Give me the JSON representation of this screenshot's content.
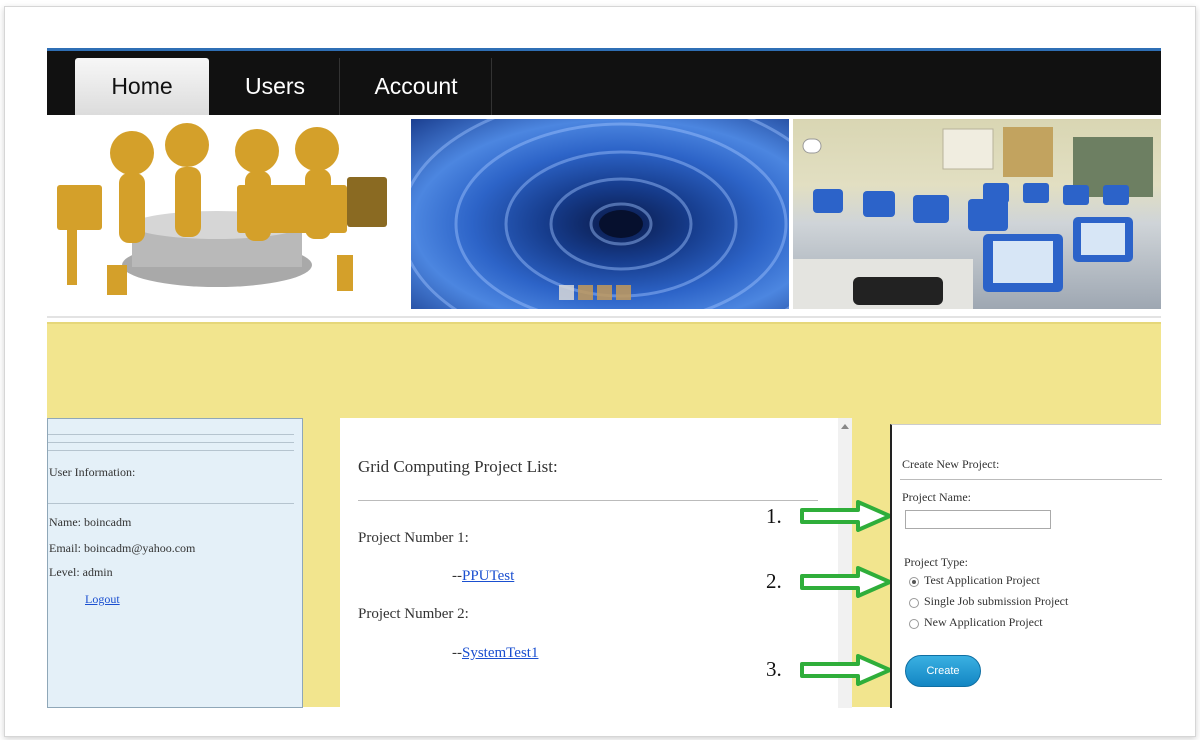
{
  "nav": {
    "tabs": [
      {
        "label": "Home",
        "active": true
      },
      {
        "label": "Users",
        "active": false
      },
      {
        "label": "Account",
        "active": false
      }
    ]
  },
  "colors": {
    "accent": "#2f6fb5",
    "content_bg": "#f2e58e",
    "arrow": "#2fae3a",
    "button": "#1d97d4"
  },
  "user_info": {
    "heading": "User Information:",
    "name": "Name: boincadm",
    "email": "Email: boincadm@yahoo.com",
    "level": "Level: admin",
    "logout": "Logout"
  },
  "project_list": {
    "title": "Grid Computing Project List:",
    "projects": [
      {
        "label": "Project Number 1:",
        "prefix": "--",
        "link": "PPUTest"
      },
      {
        "label": "Project Number 2:",
        "prefix": "--",
        "link": "SystemTest1"
      }
    ]
  },
  "annotations": {
    "steps": [
      "1.",
      "2.",
      "3."
    ]
  },
  "create_project": {
    "heading": "Create New Project:",
    "name_label": "Project Name:",
    "name_value": "",
    "type_label": "Project Type:",
    "types": [
      {
        "label": "Test Application Project",
        "selected": true
      },
      {
        "label": "Single Job submission Project",
        "selected": false
      },
      {
        "label": "New Application Project",
        "selected": false
      }
    ],
    "button": "Create"
  }
}
